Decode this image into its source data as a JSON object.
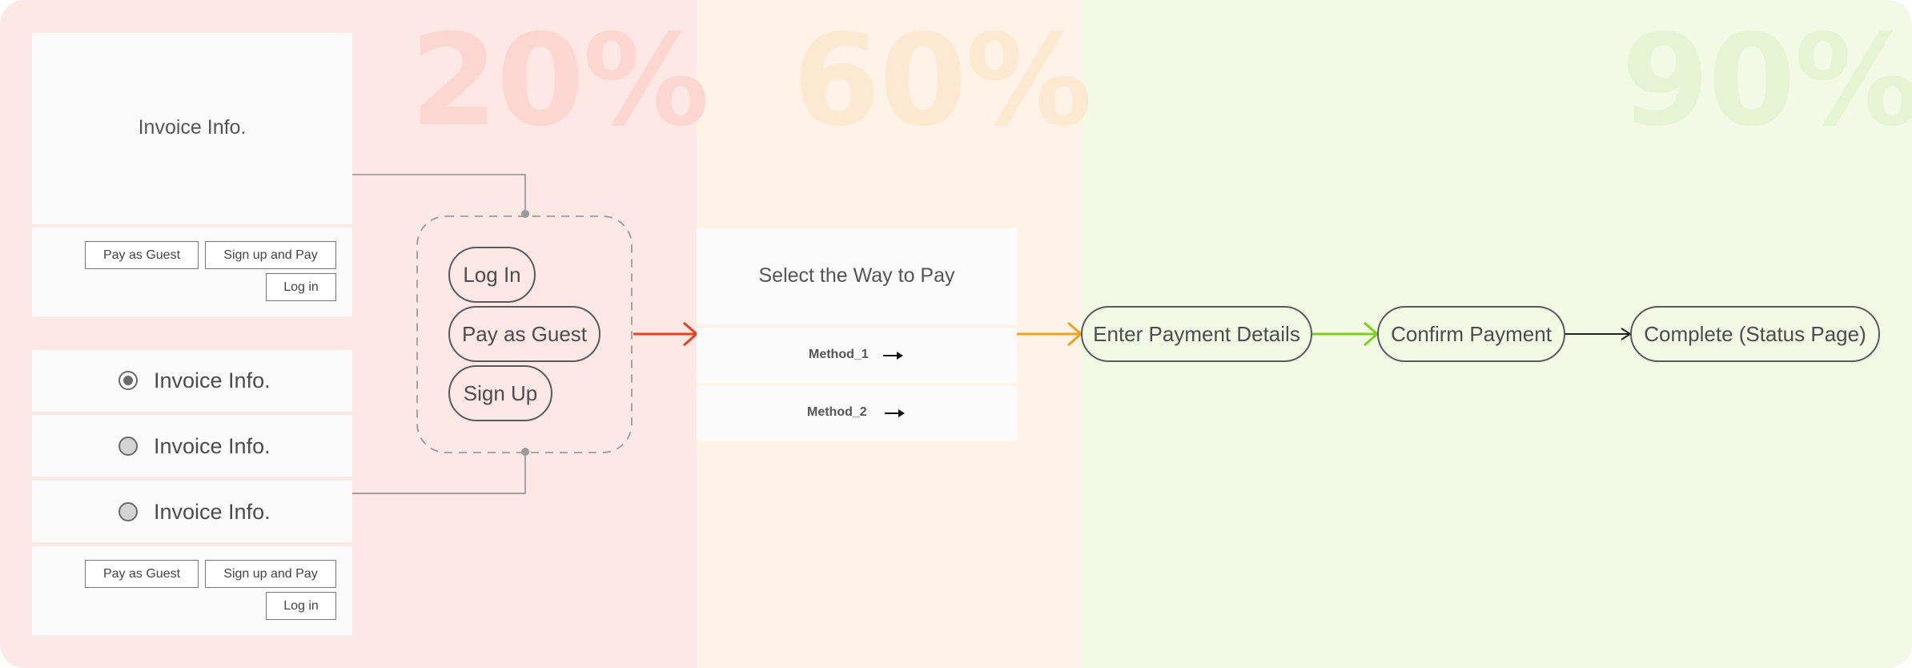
{
  "stages": [
    {
      "percent": "20%",
      "zone_color": "#fde8e6",
      "percent_color": "#fcd7d2"
    },
    {
      "percent": "60%",
      "zone_color": "#fef3e6",
      "percent_color": "#fde9d2"
    },
    {
      "percent": "90%",
      "zone_color": "#f2f9e5",
      "percent_color": "#e6f4d3"
    }
  ],
  "wireframe_top": {
    "invoice_label": "Invoice Info.",
    "buttons": {
      "guest": "Pay as Guest",
      "signup": "Sign up and Pay",
      "login": "Log in"
    }
  },
  "wireframe_bottom": {
    "rows": [
      {
        "label": "Invoice Info.",
        "selected": true
      },
      {
        "label": "Invoice Info.",
        "selected": false
      },
      {
        "label": "Invoice Info.",
        "selected": false
      }
    ],
    "buttons": {
      "guest": "Pay as Guest",
      "signup": "Sign up and Pay",
      "login": "Log in"
    }
  },
  "auth_options": {
    "login": "Log In",
    "guest": "Pay as Guest",
    "signup": "Sign Up"
  },
  "payment_select": {
    "title": "Select the Way to Pay",
    "methods": [
      "Method_1",
      "Method_2"
    ]
  },
  "flow_steps": [
    "Enter Payment Details",
    "Confirm Payment",
    "Complete (Status Page)"
  ],
  "arrow_colors": {
    "red": "#ef3e1e",
    "orange": "#f0a21e",
    "green": "#7cd11f",
    "black": "#222222"
  }
}
